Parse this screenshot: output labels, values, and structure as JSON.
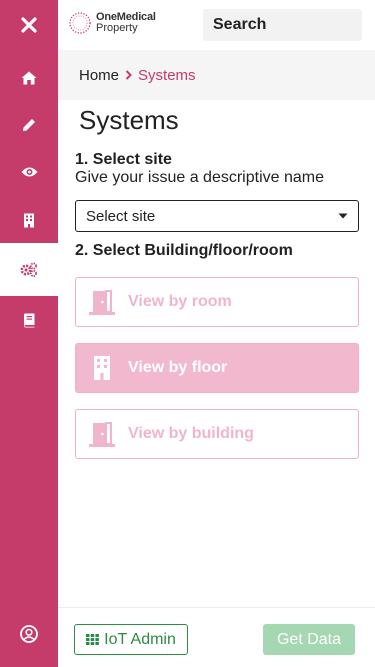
{
  "app": {
    "brand_line1": "OneMedical",
    "brand_line2": "Property"
  },
  "colors": {
    "brand": "#c53c6a",
    "option_disabled_border": "#efb1c8",
    "option_selected_bg": "#f2b8cd",
    "iot_green": "#2e8b45",
    "get_data_disabled": "#a5d7b2"
  },
  "search": {
    "placeholder": "Search",
    "value": ""
  },
  "sidebar": {
    "items": [
      {
        "icon": "close-icon",
        "active": false
      },
      {
        "icon": "home-icon",
        "active": false
      },
      {
        "icon": "pencil-icon",
        "active": false
      },
      {
        "icon": "eye-icon",
        "active": false
      },
      {
        "icon": "building-icon",
        "active": false
      },
      {
        "icon": "cogs-icon",
        "active": true
      },
      {
        "icon": "book-icon",
        "active": false
      },
      {
        "icon": "user-circle-icon",
        "active": false
      }
    ]
  },
  "breadcrumb": {
    "home": "Home",
    "current": "Systems"
  },
  "main": {
    "title": "Systems",
    "step1_title": "1. Select site",
    "step1_subtitle": "Give your issue a descriptive name",
    "site_select": {
      "value": "Select site"
    },
    "step2_title": "2. Select Building/floor/room",
    "options": [
      {
        "label": "View by room",
        "icon": "door-icon"
      },
      {
        "label": "View by floor",
        "icon": "building-icon"
      },
      {
        "label": "View by building",
        "icon": "door-icon"
      }
    ]
  },
  "footer": {
    "iot_admin_label": "IoT Admin",
    "get_data_label": "Get Data"
  }
}
